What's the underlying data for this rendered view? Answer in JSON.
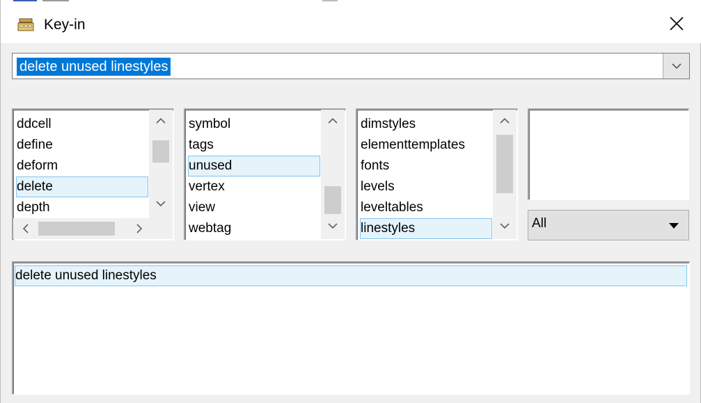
{
  "window": {
    "title": "Key-in",
    "icon": "keyboard-icon"
  },
  "command_input": {
    "value": "delete unused linestyles"
  },
  "list1": {
    "items": [
      "ddcell",
      "define",
      "deform",
      "delete",
      "depth"
    ],
    "selected": "delete"
  },
  "list2": {
    "items": [
      "symbol",
      "tags",
      "unused",
      "vertex",
      "view",
      "webtag"
    ],
    "selected": "unused"
  },
  "list3": {
    "items": [
      "dimstyles",
      "elementtemplates",
      "fonts",
      "levels",
      "leveltables",
      "linestyles"
    ],
    "selected": "linestyles"
  },
  "filter_select": {
    "value": "All"
  },
  "history": {
    "items": [
      "delete unused linestyles"
    ]
  },
  "colors": {
    "selection_blue": "#0078d7",
    "item_highlight": "#e5f3fb",
    "item_border": "#84c4ec"
  }
}
